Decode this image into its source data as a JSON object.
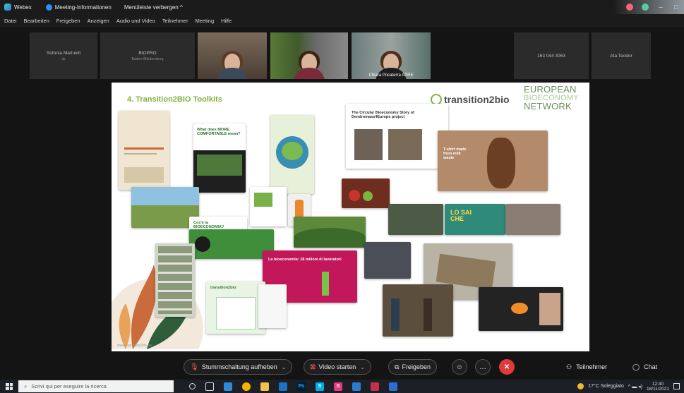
{
  "titlebar": {
    "app_name": "Webex",
    "meeting_info": "Meeting-Informationen",
    "hide_menubar": "Menüleiste verbergen",
    "hide_menubar_chevron": "^",
    "minimize": "–",
    "maximize": "□"
  },
  "menubar": {
    "items": [
      "Datei",
      "Bearbeiten",
      "Freigeben",
      "Anzeigen",
      "Audio und Video",
      "Teilnehmer",
      "Meeting",
      "Hilfe"
    ]
  },
  "participants": [
    {
      "name": "Sofonia Marinelli",
      "sub": "uk",
      "type": "name"
    },
    {
      "name": "BIOPRO",
      "sub": "Baden-Württemberg",
      "type": "name"
    },
    {
      "name": "",
      "type": "video"
    },
    {
      "name": "",
      "type": "video"
    },
    {
      "name": "Chiara Pocaterra APRE",
      "type": "video",
      "active": true
    },
    {
      "name": "",
      "type": "empty"
    },
    {
      "name": "163 044 3063",
      "type": "name"
    },
    {
      "name": "Ata Teodor",
      "type": "name"
    }
  ],
  "slide": {
    "title": "4. Transition2BIO Toolkits",
    "brand": "transition2bio",
    "ebn": [
      "EUROPEAN",
      "BIOECONOMY",
      "NETWORK"
    ],
    "card_text": {
      "comfortable": "What does MORE COMFORTABLE mean?",
      "story_title": "The Circular Bioeconomy Story of Dendromass4Europe project",
      "bioeconomia": "Cos'è la BIOECONOMIA?",
      "milioni": "La bioeconomia: 18 milioni di lavoratori",
      "losai": "LO SAI CHE",
      "t2b_card": "transition2bio",
      "shirt": "T-shirt made from milk waste",
      "footer_url": "www.transition2bio.eu"
    }
  },
  "controls": {
    "mute": "Stummschaltung aufheben",
    "video": "Video starten",
    "share": "Freigeben",
    "participants": "Teilnehmer",
    "chat": "Chat",
    "more": "…",
    "end": "✕"
  },
  "taskbar": {
    "search_placeholder": "Scrivi qui per eseguire la ricerca",
    "weather": "17°C Soleggiato",
    "time": "12:40",
    "date": "18/11/2021",
    "tray": "^ ▬ ◂)"
  },
  "colors": {
    "accent_green": "#7fb241",
    "active_blue": "#2d9cff",
    "end_red": "#e03a3a"
  }
}
